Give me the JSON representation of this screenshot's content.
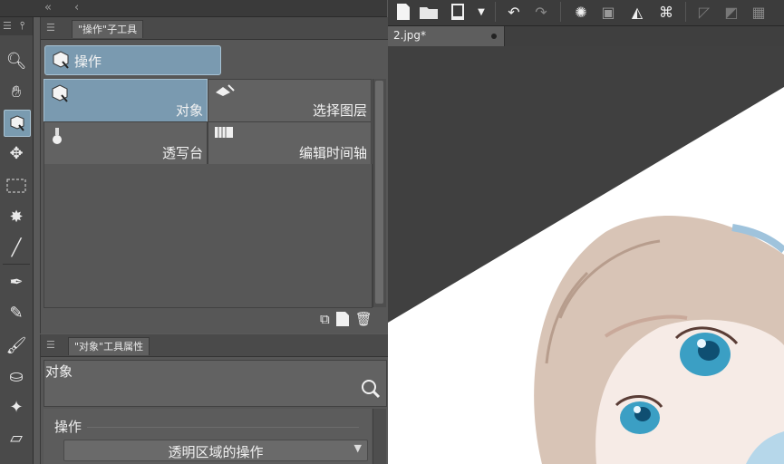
{
  "document": {
    "tab_name": "2.jpg*"
  },
  "sub_tool_panel": {
    "tab_title": "\"操作\"子工具",
    "group_label": "操作",
    "tools": [
      {
        "label": "对象",
        "icon": "cube-select-icon"
      },
      {
        "label": "选择图层",
        "icon": "layer-select-icon"
      },
      {
        "label": "透写台",
        "icon": "lightbox-icon"
      },
      {
        "label": "编辑时间轴",
        "icon": "timeline-icon"
      }
    ]
  },
  "tool_property": {
    "tab_title": "\"对象\"工具属性",
    "title": "对象",
    "section": "操作",
    "dropdown_value": "透明区域的操作"
  },
  "colors": {
    "selected": "#7a9ab0",
    "panel": "#575757",
    "canvas_bg": "#404040"
  }
}
